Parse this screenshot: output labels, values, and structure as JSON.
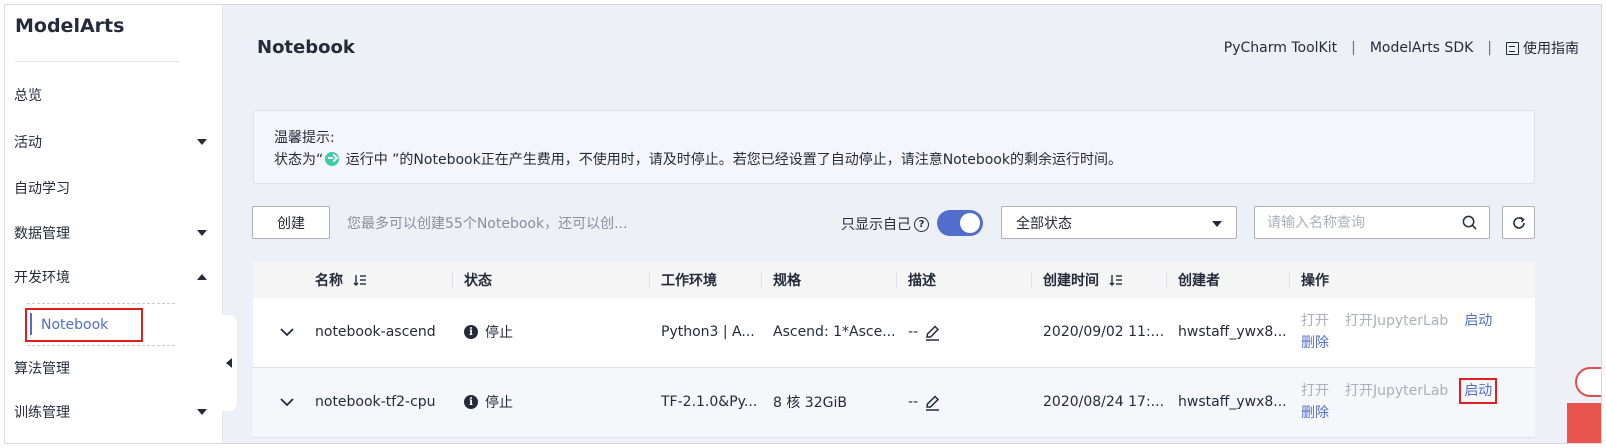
{
  "app": {
    "brand": "ModelArts"
  },
  "sidebar": {
    "items": [
      {
        "label": "总览",
        "caret": "none"
      },
      {
        "label": "活动",
        "caret": "down"
      },
      {
        "label": "自动学习",
        "caret": "none"
      },
      {
        "label": "数据管理",
        "caret": "down"
      },
      {
        "label": "开发环境",
        "caret": "up"
      },
      {
        "label": "算法管理",
        "caret": "none"
      },
      {
        "label": "训练管理",
        "caret": "down"
      }
    ],
    "sub_items": [
      {
        "label": "Notebook",
        "selected": true
      }
    ]
  },
  "header": {
    "title": "Notebook",
    "links": {
      "pycharm": "PyCharm ToolKit",
      "sdk": "ModelArts SDK",
      "separator": "|",
      "guide": "使用指南"
    }
  },
  "notice": {
    "title": "温馨提示:",
    "text_before": "状态为“",
    "status_word": "运行中",
    "text_after": "”的Notebook正在产生费用，不使用时，请及时停止。若您已经设置了自动停止，请注意Notebook的剩余运行时间。"
  },
  "toolbar": {
    "create_label": "创建",
    "create_hint": "您最多可以创建55个Notebook，还可以创...",
    "only_mine_label": "只显示自己",
    "only_mine_enabled": true,
    "status_filter": "全部状态",
    "search_placeholder": "请输入名称查询"
  },
  "table": {
    "columns": [
      "名称",
      "状态",
      "工作环境",
      "规格",
      "描述",
      "创建时间",
      "创建者",
      "操作"
    ],
    "rows": [
      {
        "name": "notebook-ascend",
        "status": "停止",
        "env": "Python3 | A...",
        "spec": "Ascend: 1*Asce...",
        "desc": "--",
        "created": "2020/09/02 11:...",
        "creator": "hwstaff_ywx8...",
        "ops": [
          "打开",
          "打开JupyterLab",
          "启动",
          "删除"
        ]
      },
      {
        "name": "notebook-tf2-cpu",
        "status": "停止",
        "env": "TF-2.1.0&Py...",
        "spec": "8 核 32GiB",
        "desc": "--",
        "created": "2020/08/24 17:...",
        "creator": "hwstaff_ywx8...",
        "ops": [
          "打开",
          "打开JupyterLab",
          "启动",
          "删除"
        ]
      }
    ]
  },
  "colors": {
    "accent": "#526ecc",
    "highlight_box": "#e02020",
    "running_green": "#3dcca6"
  }
}
